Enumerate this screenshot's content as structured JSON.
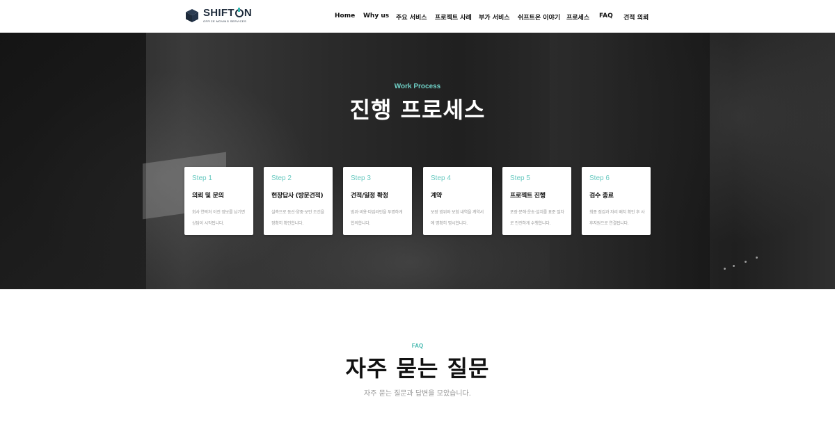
{
  "brand": {
    "name_prefix": "SHIFT",
    "name_suffix": "N",
    "tagline": "OFFICE MOVING SERVICES",
    "accent_color": "#35b7b0",
    "dark_color": "#1d2a3a"
  },
  "nav": {
    "items": [
      "Home",
      "Why us",
      "주요 서비스",
      "프로젝트 사례",
      "부가 서비스",
      "쉬프트온 이야기",
      "프로세스",
      "FAQ",
      "견적 의뢰"
    ]
  },
  "hero": {
    "kicker": "Work Process",
    "title": "진행 프로세스",
    "steps": [
      {
        "step": "Step 1",
        "title": "의뢰 및 문의",
        "desc": "회사 연락처 이전 정보를 남기면 상담이 시작됩니다."
      },
      {
        "step": "Step 2",
        "title": "현장답사 (방문견적)",
        "desc": "실측으로 동선·양중·보안 조건을 정확히 확인합니다."
      },
      {
        "step": "Step 3",
        "title": "견적/일정 확정",
        "desc": "범위·비용·타임라인을 투명하게 합의합니다."
      },
      {
        "step": "Step 4",
        "title": "계약",
        "desc": "보장 범위와 보험 내역을 계약서에 명확히 명시합니다."
      },
      {
        "step": "Step 5",
        "title": "프로젝트 진행",
        "desc": "포장·분해·운송·설치를 표준 절차로 안전하게 수행합니다."
      },
      {
        "step": "Step 6",
        "title": "검수 종료",
        "desc": "최종 점검과 자리 배치 확인 후 사후지원으로 연결됩니다."
      }
    ]
  },
  "faq": {
    "kicker": "FAQ",
    "title": "자주 묻는 질문",
    "subtitle": "자주 묻는 질문과 답변을 모았습니다."
  }
}
